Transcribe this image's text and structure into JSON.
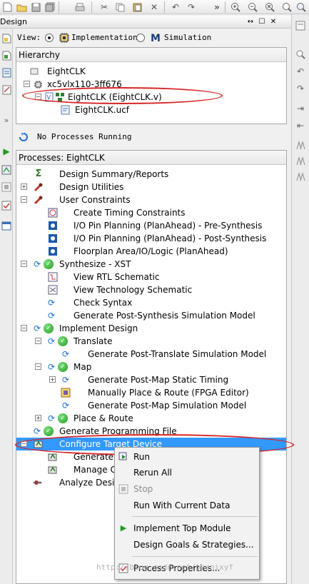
{
  "panel": {
    "title": "Design",
    "close_glyph": "✕",
    "pin_glyph": "↔",
    "float_glyph": "☐"
  },
  "view": {
    "label": "View:",
    "implementation": "Implementation",
    "simulation": "Simulation",
    "selected": "Implementation"
  },
  "hierarchy": {
    "header": "Hierarchy",
    "items": [
      {
        "label": "EightCLK"
      },
      {
        "label": "xc5vlx110-3ff676"
      },
      {
        "label": "EightCLK (EightCLK.v)"
      },
      {
        "label": "EightCLK.ucf"
      }
    ]
  },
  "status": "No Processes Running",
  "processes": {
    "header": "Processes: EightCLK",
    "items": [
      {
        "label": "Design Summary/Reports"
      },
      {
        "label": "Design Utilities"
      },
      {
        "label": "User Constraints"
      },
      {
        "label": "Create Timing Constraints"
      },
      {
        "label": "I/O Pin Planning (PlanAhead) - Pre-Synthesis"
      },
      {
        "label": "I/O Pin Planning (PlanAhead) - Post-Synthesis"
      },
      {
        "label": "Floorplan Area/IO/Logic (PlanAhead)"
      },
      {
        "label": "Synthesize - XST"
      },
      {
        "label": "View RTL Schematic"
      },
      {
        "label": "View Technology Schematic"
      },
      {
        "label": "Check Syntax"
      },
      {
        "label": "Generate Post-Synthesis Simulation Model"
      },
      {
        "label": "Implement Design"
      },
      {
        "label": "Translate"
      },
      {
        "label": "Generate Post-Translate Simulation Model"
      },
      {
        "label": "Map"
      },
      {
        "label": "Generate Post-Map Static Timing"
      },
      {
        "label": "Manually Place & Route (FPGA Editor)"
      },
      {
        "label": "Generate Post-Map Simulation Model"
      },
      {
        "label": "Place & Route"
      },
      {
        "label": "Generate Programming File"
      },
      {
        "label": "Configure Target Device"
      },
      {
        "label": "Generate"
      },
      {
        "label": "Manage C"
      },
      {
        "label": "Analyze Desi"
      }
    ]
  },
  "context_menu": {
    "items": [
      {
        "label": "Run"
      },
      {
        "label": "Rerun All"
      },
      {
        "label": "Stop"
      },
      {
        "label": "Run With Current Data"
      },
      {
        "label": "Implement Top Module"
      },
      {
        "label": "Design Goals & Strategies..."
      },
      {
        "label": "Process Properties..."
      }
    ]
  },
  "watermark": "http://blog.csdn.net/phenixyf",
  "colors": {
    "selection": "#3399ff",
    "annotation": "#d62626",
    "ok": "#1e9a1e",
    "run": "#1b6fd1"
  },
  "icons": {
    "toolbar": [
      "new-file-icon",
      "open-folder-icon",
      "save-icon",
      "save-all-icon",
      "print-icon",
      "cut-icon",
      "copy-icon",
      "paste-icon",
      "delete-icon",
      "undo-icon",
      "redo-icon",
      "more-icon",
      "zoom-in-icon",
      "zoom-out-icon",
      "zoom-fit-icon",
      "zoom-full-icon",
      "zoom-area-icon"
    ]
  }
}
